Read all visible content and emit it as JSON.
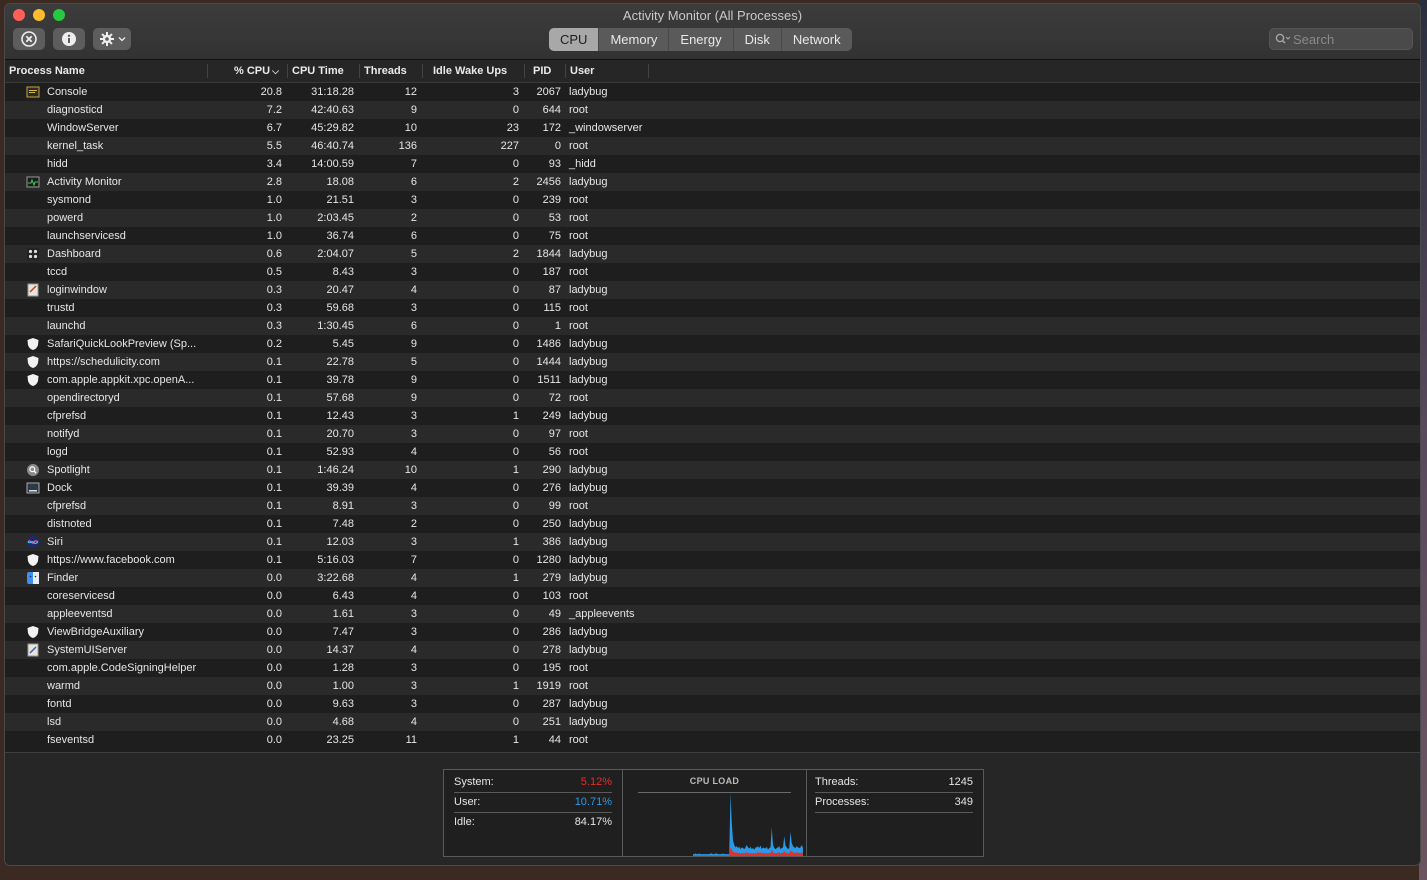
{
  "window": {
    "title": "Activity Monitor (All Processes)"
  },
  "toolbar": {
    "tabs": [
      {
        "label": "CPU",
        "active": true
      },
      {
        "label": "Memory",
        "active": false
      },
      {
        "label": "Energy",
        "active": false
      },
      {
        "label": "Disk",
        "active": false
      },
      {
        "label": "Network",
        "active": false
      }
    ],
    "search_placeholder": "Search"
  },
  "columns": [
    "Process Name",
    "% CPU",
    "CPU Time",
    "Threads",
    "Idle Wake Ups",
    "PID",
    "User"
  ],
  "processes": [
    {
      "name": "Console",
      "icon": "console-icon",
      "cpu": "20.8",
      "time": "31:18.28",
      "threads": "12",
      "idle": "3",
      "pid": "2067",
      "user": "ladybug"
    },
    {
      "name": "diagnosticd",
      "icon": "",
      "cpu": "7.2",
      "time": "42:40.63",
      "threads": "9",
      "idle": "0",
      "pid": "644",
      "user": "root"
    },
    {
      "name": "WindowServer",
      "icon": "",
      "cpu": "6.7",
      "time": "45:29.82",
      "threads": "10",
      "idle": "23",
      "pid": "172",
      "user": "_windowserver"
    },
    {
      "name": "kernel_task",
      "icon": "",
      "cpu": "5.5",
      "time": "46:40.74",
      "threads": "136",
      "idle": "227",
      "pid": "0",
      "user": "root"
    },
    {
      "name": "hidd",
      "icon": "",
      "cpu": "3.4",
      "time": "14:00.59",
      "threads": "7",
      "idle": "0",
      "pid": "93",
      "user": "_hidd"
    },
    {
      "name": "Activity Monitor",
      "icon": "activity-monitor-icon",
      "cpu": "2.8",
      "time": "18.08",
      "threads": "6",
      "idle": "2",
      "pid": "2456",
      "user": "ladybug"
    },
    {
      "name": "sysmond",
      "icon": "",
      "cpu": "1.0",
      "time": "21.51",
      "threads": "3",
      "idle": "0",
      "pid": "239",
      "user": "root"
    },
    {
      "name": "powerd",
      "icon": "",
      "cpu": "1.0",
      "time": "2:03.45",
      "threads": "2",
      "idle": "0",
      "pid": "53",
      "user": "root"
    },
    {
      "name": "launchservicesd",
      "icon": "",
      "cpu": "1.0",
      "time": "36.74",
      "threads": "6",
      "idle": "0",
      "pid": "75",
      "user": "root"
    },
    {
      "name": "Dashboard",
      "icon": "dashboard-icon",
      "cpu": "0.6",
      "time": "2:04.07",
      "threads": "5",
      "idle": "2",
      "pid": "1844",
      "user": "ladybug"
    },
    {
      "name": "tccd",
      "icon": "",
      "cpu": "0.5",
      "time": "8.43",
      "threads": "3",
      "idle": "0",
      "pid": "187",
      "user": "root"
    },
    {
      "name": "loginwindow",
      "icon": "loginwindow-icon",
      "cpu": "0.3",
      "time": "20.47",
      "threads": "4",
      "idle": "0",
      "pid": "87",
      "user": "ladybug"
    },
    {
      "name": "trustd",
      "icon": "",
      "cpu": "0.3",
      "time": "59.68",
      "threads": "3",
      "idle": "0",
      "pid": "115",
      "user": "root"
    },
    {
      "name": "launchd",
      "icon": "",
      "cpu": "0.3",
      "time": "1:30.45",
      "threads": "6",
      "idle": "0",
      "pid": "1",
      "user": "root"
    },
    {
      "name": "SafariQuickLookPreview (Sp...",
      "icon": "shield-icon",
      "cpu": "0.2",
      "time": "5.45",
      "threads": "9",
      "idle": "0",
      "pid": "1486",
      "user": "ladybug"
    },
    {
      "name": "https://schedulicity.com",
      "icon": "shield-icon",
      "cpu": "0.1",
      "time": "22.78",
      "threads": "5",
      "idle": "0",
      "pid": "1444",
      "user": "ladybug"
    },
    {
      "name": "com.apple.appkit.xpc.openA...",
      "icon": "shield-icon",
      "cpu": "0.1",
      "time": "39.78",
      "threads": "9",
      "idle": "0",
      "pid": "1511",
      "user": "ladybug"
    },
    {
      "name": "opendirectoryd",
      "icon": "",
      "cpu": "0.1",
      "time": "57.68",
      "threads": "9",
      "idle": "0",
      "pid": "72",
      "user": "root"
    },
    {
      "name": "cfprefsd",
      "icon": "",
      "cpu": "0.1",
      "time": "12.43",
      "threads": "3",
      "idle": "1",
      "pid": "249",
      "user": "ladybug"
    },
    {
      "name": "notifyd",
      "icon": "",
      "cpu": "0.1",
      "time": "20.70",
      "threads": "3",
      "idle": "0",
      "pid": "97",
      "user": "root"
    },
    {
      "name": "logd",
      "icon": "",
      "cpu": "0.1",
      "time": "52.93",
      "threads": "4",
      "idle": "0",
      "pid": "56",
      "user": "root"
    },
    {
      "name": "Spotlight",
      "icon": "spotlight-icon",
      "cpu": "0.1",
      "time": "1:46.24",
      "threads": "10",
      "idle": "1",
      "pid": "290",
      "user": "ladybug"
    },
    {
      "name": "Dock",
      "icon": "dock-icon",
      "cpu": "0.1",
      "time": "39.39",
      "threads": "4",
      "idle": "0",
      "pid": "276",
      "user": "ladybug"
    },
    {
      "name": "cfprefsd",
      "icon": "",
      "cpu": "0.1",
      "time": "8.91",
      "threads": "3",
      "idle": "0",
      "pid": "99",
      "user": "root"
    },
    {
      "name": "distnoted",
      "icon": "",
      "cpu": "0.1",
      "time": "7.48",
      "threads": "2",
      "idle": "0",
      "pid": "250",
      "user": "ladybug"
    },
    {
      "name": "Siri",
      "icon": "siri-icon",
      "cpu": "0.1",
      "time": "12.03",
      "threads": "3",
      "idle": "1",
      "pid": "386",
      "user": "ladybug"
    },
    {
      "name": "https://www.facebook.com",
      "icon": "shield-icon",
      "cpu": "0.1",
      "time": "5:16.03",
      "threads": "7",
      "idle": "0",
      "pid": "1280",
      "user": "ladybug"
    },
    {
      "name": "Finder",
      "icon": "finder-icon",
      "cpu": "0.0",
      "time": "3:22.68",
      "threads": "4",
      "idle": "1",
      "pid": "279",
      "user": "ladybug"
    },
    {
      "name": "coreservicesd",
      "icon": "",
      "cpu": "0.0",
      "time": "6.43",
      "threads": "4",
      "idle": "0",
      "pid": "103",
      "user": "root"
    },
    {
      "name": "appleeventsd",
      "icon": "",
      "cpu": "0.0",
      "time": "1.61",
      "threads": "3",
      "idle": "0",
      "pid": "49",
      "user": "_appleevents"
    },
    {
      "name": "ViewBridgeAuxiliary",
      "icon": "shield-icon",
      "cpu": "0.0",
      "time": "7.47",
      "threads": "3",
      "idle": "0",
      "pid": "286",
      "user": "ladybug"
    },
    {
      "name": "SystemUIServer",
      "icon": "systemuiserver-icon",
      "cpu": "0.0",
      "time": "14.37",
      "threads": "4",
      "idle": "0",
      "pid": "278",
      "user": "ladybug"
    },
    {
      "name": "com.apple.CodeSigningHelper",
      "icon": "",
      "cpu": "0.0",
      "time": "1.28",
      "threads": "3",
      "idle": "0",
      "pid": "195",
      "user": "root"
    },
    {
      "name": "warmd",
      "icon": "",
      "cpu": "0.0",
      "time": "1.00",
      "threads": "3",
      "idle": "1",
      "pid": "1919",
      "user": "root"
    },
    {
      "name": "fontd",
      "icon": "",
      "cpu": "0.0",
      "time": "9.63",
      "threads": "3",
      "idle": "0",
      "pid": "287",
      "user": "ladybug"
    },
    {
      "name": "lsd",
      "icon": "",
      "cpu": "0.0",
      "time": "4.68",
      "threads": "4",
      "idle": "0",
      "pid": "251",
      "user": "ladybug"
    },
    {
      "name": "fseventsd",
      "icon": "",
      "cpu": "0.0",
      "time": "23.25",
      "threads": "11",
      "idle": "1",
      "pid": "44",
      "user": "root"
    }
  ],
  "summary": {
    "system_label": "System:",
    "system_value": "5.12%",
    "system_color": "#e0312b",
    "user_label": "User:",
    "user_value": "10.71%",
    "user_color": "#2a9ae8",
    "idle_label": "Idle:",
    "idle_value": "84.17%",
    "graph_title": "CPU LOAD",
    "threads_label": "Threads:",
    "threads_value": "1245",
    "processes_label": "Processes:",
    "processes_value": "349"
  },
  "cpu_load_graph": {
    "user_percent": [
      2,
      2,
      3,
      2,
      2,
      3,
      2,
      2,
      2,
      2,
      2,
      2,
      2,
      2,
      3,
      3,
      2,
      2,
      3,
      3,
      2,
      2,
      2,
      2,
      3,
      2,
      2,
      2,
      2,
      2,
      88,
      44,
      18,
      12,
      9,
      10,
      8,
      10,
      7,
      9,
      8,
      7,
      9,
      12,
      9,
      8,
      10,
      7,
      8,
      6,
      9,
      9,
      10,
      8,
      11,
      7,
      9,
      8,
      8,
      10,
      6,
      8,
      9,
      36,
      12,
      8,
      7,
      8,
      9,
      10,
      7,
      8,
      9,
      24,
      11,
      9,
      7,
      8,
      30,
      14,
      10,
      9,
      8,
      10,
      9,
      8,
      9,
      12,
      8
    ],
    "system_percent": [
      1,
      1,
      1,
      1,
      1,
      1,
      1,
      1,
      1,
      1,
      1,
      1,
      1,
      1,
      1,
      1,
      1,
      1,
      1,
      1,
      1,
      1,
      1,
      1,
      1,
      1,
      1,
      1,
      1,
      1,
      14,
      10,
      7,
      6,
      5,
      6,
      5,
      5,
      4,
      5,
      5,
      4,
      5,
      6,
      5,
      4,
      5,
      4,
      5,
      4,
      5,
      5,
      6,
      5,
      6,
      4,
      5,
      5,
      4,
      5,
      4,
      5,
      5,
      10,
      6,
      5,
      4,
      5,
      5,
      6,
      4,
      5,
      5,
      8,
      6,
      5,
      4,
      5,
      9,
      7,
      6,
      5,
      5,
      6,
      5,
      5,
      5,
      6,
      5
    ]
  }
}
